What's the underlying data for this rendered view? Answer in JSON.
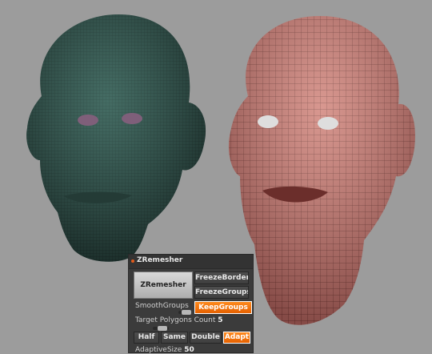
{
  "panel": {
    "title": "ZRemesher",
    "zremesher_label": "ZRemesher",
    "freeze_border_label": "FreezeBorder",
    "freeze_groups_label": "FreezeGroups",
    "smooth_groups_label": "SmoothGroups",
    "keep_groups_label": "KeepGroups",
    "target_polygons_label": "Target Polygons Count",
    "target_polygons_value": "5",
    "half_label": "Half",
    "same_label": "Same",
    "double_label": "Double",
    "adapt_label": "Adapt",
    "adaptive_size_label": "AdaptiveSize",
    "adaptive_size_value": "50",
    "accent_color": "#f07a10"
  },
  "viewport": {
    "left_mesh_color": "#2f4f48",
    "right_mesh_color": "#c57a73",
    "background_color": "#9c9c9c"
  }
}
